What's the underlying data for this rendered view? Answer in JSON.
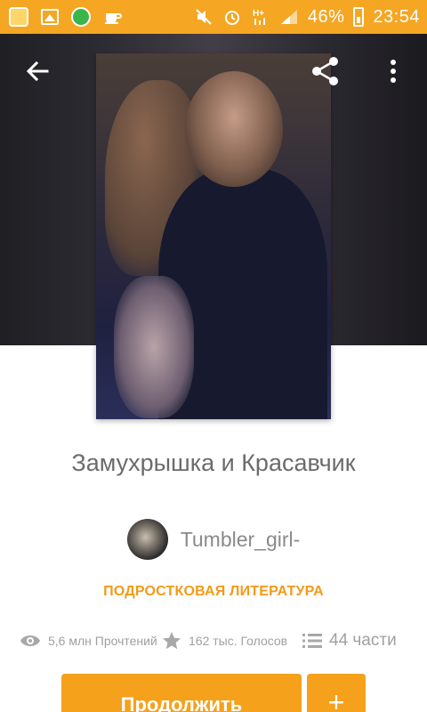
{
  "status_bar": {
    "battery": "46%",
    "time": "23:54",
    "icons": [
      "app-icon",
      "gallery-icon",
      "green-app-icon",
      "teacup-icon",
      "mute-icon",
      "alarm-icon",
      "h-plus-icon",
      "signal-icon",
      "battery-icon"
    ]
  },
  "header": {
    "icons": [
      "back-arrow-icon",
      "share-icon",
      "more-vert-icon"
    ]
  },
  "story": {
    "title": "Замухрышка и Красавчик",
    "author": "Tumbler_girl-",
    "category": "ПОДРОСТКОВАЯ ЛИТЕРАТУРА",
    "reads": "5,6 млн Прочтений",
    "votes": "162 тыс. Голосов",
    "parts": "44 части"
  },
  "actions": {
    "continue_label": "Продолжить",
    "add_label": "+"
  },
  "colors": {
    "accent": "#f5a11c",
    "status_bar": "#f5a623",
    "category": "#f29a1a"
  }
}
